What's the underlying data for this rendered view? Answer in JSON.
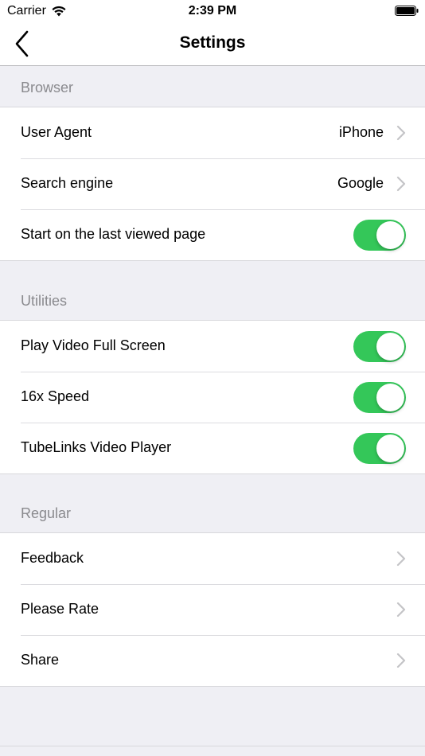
{
  "status_bar": {
    "carrier": "Carrier",
    "time": "2:39 PM"
  },
  "nav": {
    "title": "Settings"
  },
  "sections": [
    {
      "header": "Browser",
      "rows": [
        {
          "label": "User Agent",
          "value": "iPhone",
          "type": "disclosure"
        },
        {
          "label": "Search engine",
          "value": "Google",
          "type": "disclosure"
        },
        {
          "label": "Start on the last viewed page",
          "type": "toggle",
          "on": true
        }
      ]
    },
    {
      "header": "Utilities",
      "rows": [
        {
          "label": "Play Video Full Screen",
          "type": "toggle",
          "on": true
        },
        {
          "label": "16x Speed",
          "type": "toggle",
          "on": true
        },
        {
          "label": "TubeLinks Video Player",
          "type": "toggle",
          "on": true
        }
      ]
    },
    {
      "header": "Regular",
      "rows": [
        {
          "label": "Feedback",
          "type": "disclosure"
        },
        {
          "label": "Please Rate",
          "type": "disclosure"
        },
        {
          "label": "Share",
          "type": "disclosure"
        }
      ]
    }
  ],
  "colors": {
    "toggle_on": "#34c759",
    "background": "#efeff4",
    "section_header_text": "#8a8a8e",
    "chevron": "#c4c4c7"
  }
}
